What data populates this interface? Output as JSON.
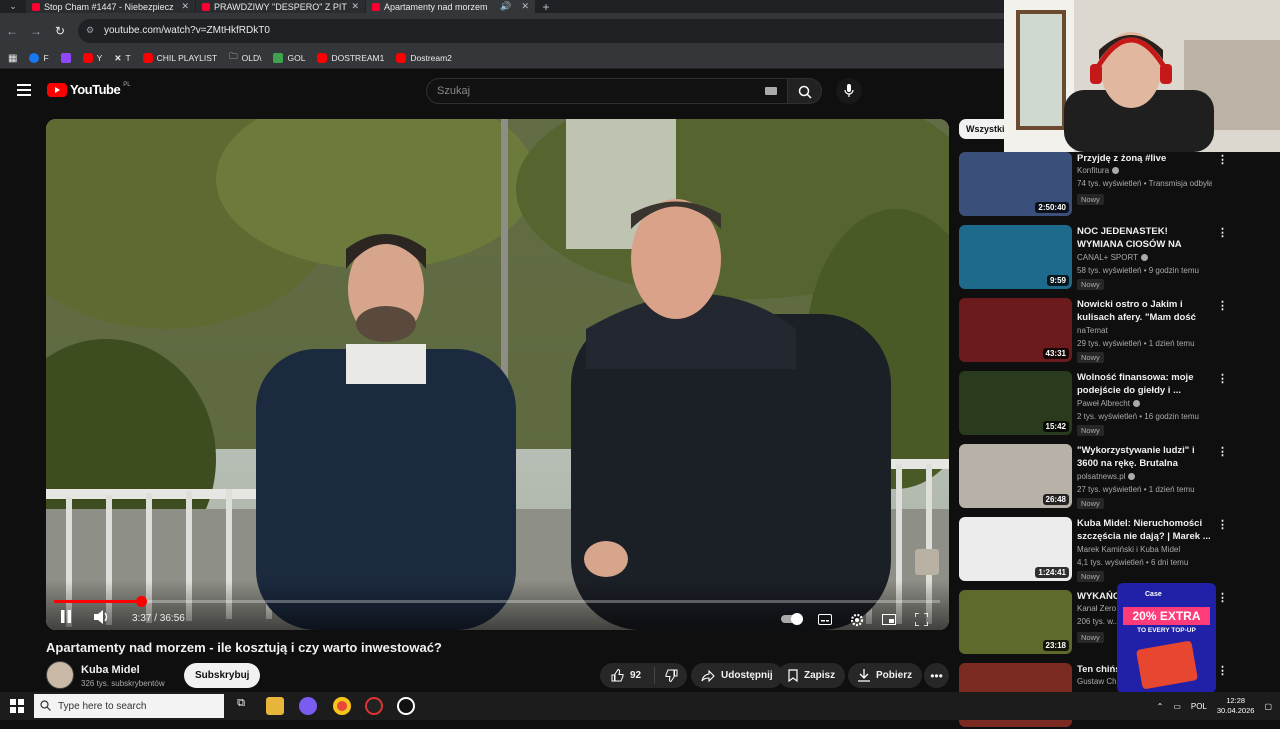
{
  "browser": {
    "tabs": [
      {
        "title": "Stop Cham #1447 - Niebezpiecz",
        "active": false
      },
      {
        "title": "PRAWDZIWY \"DESPERO\" Z PITB",
        "active": false
      },
      {
        "title": "Apartamenty nad morzem",
        "active": true
      }
    ],
    "url": "youtube.com/watch?v=ZMtHkfRDkT0",
    "bookmarks": [
      "F",
      "Y",
      "T",
      "CHIL PLAYLIST",
      "OLD\\",
      "GOL",
      "DOSTREAM1",
      "Dostream2"
    ]
  },
  "youtube": {
    "logo_text": "YouTube",
    "logo_country": "PL",
    "search_placeholder": "Szukaj"
  },
  "player": {
    "current_time": "3:37 / 36:56",
    "progress_fraction": 0.098
  },
  "video": {
    "title": "Apartamenty nad morzem - ile kosztują i czy warto inwestować?",
    "channel": "Kuba Midel",
    "subscribers": "326 tys. subskrybentów",
    "subscribe_label": "Subskrybuj",
    "likes": "92",
    "share_label": "Udostępnij",
    "save_label": "Zapisz",
    "download_label": "Pobierz"
  },
  "sidebar": {
    "chip_all": "Wszystki",
    "recommendations": [
      {
        "title": "Przyjdę z żoną #live",
        "channel": "Konfitura",
        "verified": true,
        "meta": "74 tys. wyświetleń • Transmisja odbyła s...",
        "badge": "Nowy",
        "duration": "2:50:40",
        "thumb_color": "#3a4f7a"
      },
      {
        "title": "NOC JEDENASTEK! WYMIANA CIOSÓW NA METROPOLITAN...",
        "channel": "CANAL+ SPORT",
        "verified": true,
        "meta": "58 tys. wyświetleń • 9 godzin temu",
        "badge": "Nowy",
        "duration": "9:59",
        "thumb_color": "#1d6a8c"
      },
      {
        "title": "Nowicki ostro o Jakim i kulisach afery. \"Mam dość manipulacji!\"",
        "channel": "naTemat",
        "verified": false,
        "meta": "29 tys. wyświetleń • 1 dzień temu",
        "badge": "Nowy",
        "duration": "43:31",
        "thumb_color": "#6b1b1b"
      },
      {
        "title": "Wolność finansowa: moje podejście do giełdy i ...",
        "channel": "Paweł Albrecht",
        "verified": true,
        "meta": "2 tys. wyświetleń • 16 godzin temu",
        "badge": "Nowy",
        "duration": "15:42",
        "thumb_color": "#2a3a1c"
      },
      {
        "title": "\"Wykorzystywanie ludzi\" i 3600 na rękę. Brutalna prawda",
        "channel": "polsatnews.pl",
        "verified": true,
        "meta": "27 tys. wyświetleń • 1 dzień temu",
        "badge": "Nowy",
        "duration": "26:48",
        "thumb_color": "#b7b1a8"
      },
      {
        "title": "Kuba Midel: Nieruchomości szczęścia nie dają? | Marek ...",
        "channel": "Marek Kamiński i Kuba Midel",
        "verified": false,
        "meta": "4,1 tys. wyświetleń • 6 dni temu",
        "badge": "Nowy",
        "duration": "1:24:41",
        "thumb_color": "#ececec"
      },
      {
        "title": "WYKAŃC... WAŻĆ N...",
        "channel": "Kanał Zero",
        "verified": false,
        "meta": "206 tys. w...",
        "badge": "Nowy",
        "duration": "23:18",
        "thumb_color": "#5e6a2b"
      },
      {
        "title": "Ten chińs... zaskoczył...",
        "channel": "Gustaw Chiny",
        "verified": false,
        "meta": "",
        "badge": "",
        "duration": "",
        "thumb_color": "#7a2a20"
      }
    ]
  },
  "ad": {
    "brand": "Case",
    "headline": "20% EXTRA",
    "subline": "TO EVERY TOP-UP"
  },
  "taskbar": {
    "search_placeholder": "Type here to search",
    "language": "POL",
    "time": "12:28",
    "date": "30.04.2026"
  }
}
